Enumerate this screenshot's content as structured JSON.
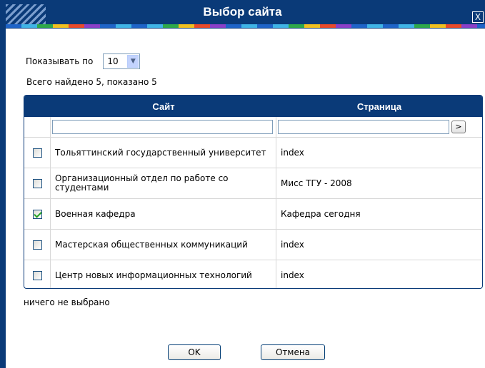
{
  "dialog": {
    "title": "Выбор сайта",
    "close_label": "X"
  },
  "paging": {
    "show_label": "Показывать по",
    "per_page": "10",
    "found_text": "Всего найдено 5, показано 5"
  },
  "table": {
    "headers": {
      "site": "Сайт",
      "page": "Страница"
    },
    "filter_button": ">",
    "rows": [
      {
        "site": "Тольяттинский государственный университет",
        "page": "index",
        "checked": false
      },
      {
        "site": "Организационный отдел по работе со студентами",
        "page": "Мисс ТГУ - 2008",
        "checked": false
      },
      {
        "site": "Военная кафедра",
        "page": "Кафедра сегодня",
        "checked": true
      },
      {
        "site": "Мастерская общественных коммуникаций",
        "page": "index",
        "checked": false
      },
      {
        "site": "Центр новых информационных технологий",
        "page": "index",
        "checked": false
      }
    ]
  },
  "status": "ничего не выбрано",
  "buttons": {
    "ok": "OK",
    "cancel": "Отмена"
  },
  "colors": {
    "titlebar": "#0a3a78",
    "check": "#21a121"
  }
}
